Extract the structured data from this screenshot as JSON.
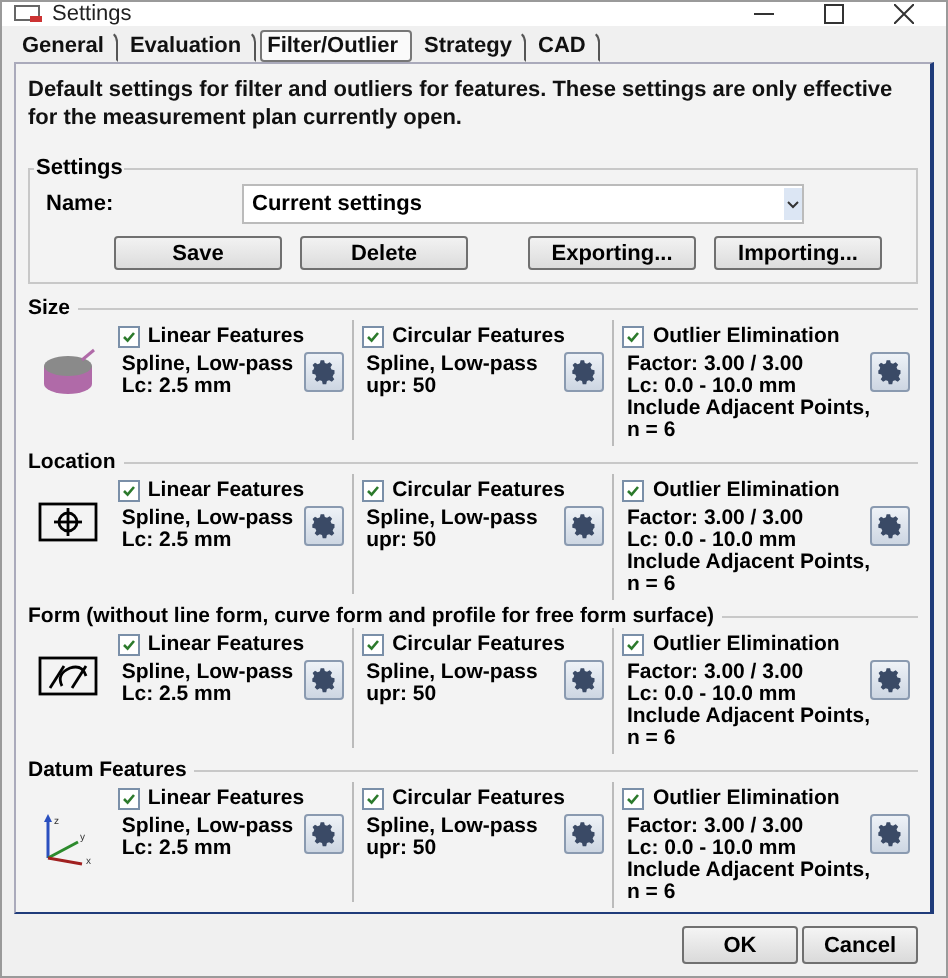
{
  "window": {
    "title": "Settings"
  },
  "tabs": [
    {
      "label": "General",
      "selected": false
    },
    {
      "label": "Evaluation",
      "selected": false
    },
    {
      "label": "Filter/Outlier",
      "selected": true
    },
    {
      "label": "Strategy",
      "selected": false
    },
    {
      "label": "CAD",
      "selected": false
    }
  ],
  "description": "Default settings for filter and outliers for features. These settings are only effective for the measurement plan currently open.",
  "settings": {
    "title": "Settings",
    "name_label": "Name:",
    "name_value": "Current settings",
    "buttons": [
      "Save",
      "Delete",
      "Exporting...",
      "Importing..."
    ]
  },
  "sections": [
    {
      "title": "Size",
      "kind": "cylinder",
      "columns": [
        {
          "label": "Linear Features",
          "checked": true,
          "lines": [
            "Spline, Low-pass",
            "Lc: 2.5 mm"
          ]
        },
        {
          "label": "Circular Features",
          "checked": true,
          "lines": [
            "Spline, Low-pass",
            "upr: 50"
          ]
        },
        {
          "label": "Outlier Elimination",
          "checked": true,
          "lines": [
            "Factor: 3.00 / 3.00",
            "Lc: 0.0 - 10.0 mm",
            "Include Adjacent Points,",
            "n = 6"
          ]
        }
      ]
    },
    {
      "title": "Location",
      "kind": "position",
      "columns": [
        {
          "label": "Linear Features",
          "checked": true,
          "lines": [
            "Spline, Low-pass",
            "Lc: 2.5 mm"
          ]
        },
        {
          "label": "Circular Features",
          "checked": true,
          "lines": [
            "Spline, Low-pass",
            "upr: 50"
          ]
        },
        {
          "label": "Outlier Elimination",
          "checked": true,
          "lines": [
            "Factor: 3.00 / 3.00",
            "Lc: 0.0 - 10.0 mm",
            "Include Adjacent Points,",
            "n = 6"
          ]
        }
      ]
    },
    {
      "title": "Form (without line form, curve form and profile for free form surface)",
      "kind": "profile",
      "columns": [
        {
          "label": "Linear Features",
          "checked": true,
          "lines": [
            "Spline, Low-pass",
            "Lc: 2.5 mm"
          ]
        },
        {
          "label": "Circular Features",
          "checked": true,
          "lines": [
            "Spline, Low-pass",
            "upr: 50"
          ]
        },
        {
          "label": "Outlier Elimination",
          "checked": true,
          "lines": [
            "Factor: 3.00 / 3.00",
            "Lc: 0.0 - 10.0 mm",
            "Include Adjacent Points,",
            "n = 6"
          ]
        }
      ]
    },
    {
      "title": "Datum Features",
      "kind": "axes",
      "axis_labels": [
        "z",
        "y",
        "x"
      ],
      "columns": [
        {
          "label": "Linear Features",
          "checked": true,
          "lines": [
            "Spline, Low-pass",
            "Lc: 2.5 mm"
          ]
        },
        {
          "label": "Circular Features",
          "checked": true,
          "lines": [
            "Spline, Low-pass",
            "upr: 50"
          ]
        },
        {
          "label": "Outlier Elimination",
          "checked": true,
          "lines": [
            "Factor: 3.00 / 3.00",
            "Lc: 0.0 - 10.0 mm",
            "Include Adjacent Points,",
            "n = 6"
          ]
        }
      ]
    }
  ],
  "footer": {
    "buttons": [
      "OK",
      "Cancel"
    ]
  }
}
